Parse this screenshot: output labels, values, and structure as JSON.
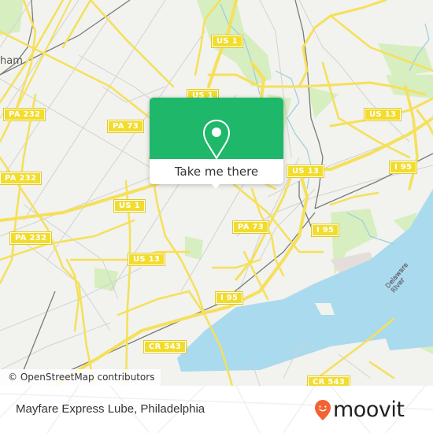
{
  "map": {
    "place_labels": [
      {
        "id": "bensalem-partial",
        "text": "ham"
      }
    ],
    "road_shields": [
      {
        "id": "us1-top",
        "text": "US 1"
      },
      {
        "id": "us1-popup",
        "text": "US 1"
      },
      {
        "id": "pa232-upper",
        "text": "PA 232"
      },
      {
        "id": "pa73-left",
        "text": "PA 73"
      },
      {
        "id": "us13-right",
        "text": "US 13"
      },
      {
        "id": "pa232-mid",
        "text": "PA 232"
      },
      {
        "id": "us1-mid",
        "text": "US 1"
      },
      {
        "id": "pa232-lower",
        "text": "PA 232"
      },
      {
        "id": "us13-upper",
        "text": "US 13"
      },
      {
        "id": "pa73-right",
        "text": "PA 73"
      },
      {
        "id": "i95-upper",
        "text": "I 95"
      },
      {
        "id": "us13-lower",
        "text": "US 13"
      },
      {
        "id": "i95-mid",
        "text": "I 95"
      },
      {
        "id": "i95-lower",
        "text": "I 95"
      },
      {
        "id": "cr543",
        "text": "CR 543"
      }
    ],
    "water_label": "Delaware River",
    "attribution": "© OpenStreetMap contributors",
    "colors": {
      "land": "#f2f2ee",
      "water": "#aadaee",
      "park": "#d7eec0",
      "major_road": "#f5e05a",
      "minor_road": "#cfcfcf",
      "rail": "#777777"
    }
  },
  "popup": {
    "icon": "map-pin-icon",
    "button_label": "Take me there",
    "color": "#1fb86a"
  },
  "footer": {
    "title": "Mayfare Express Lube, Philadelphia",
    "logo_text": "moovit",
    "logo_color": "#f26334"
  }
}
